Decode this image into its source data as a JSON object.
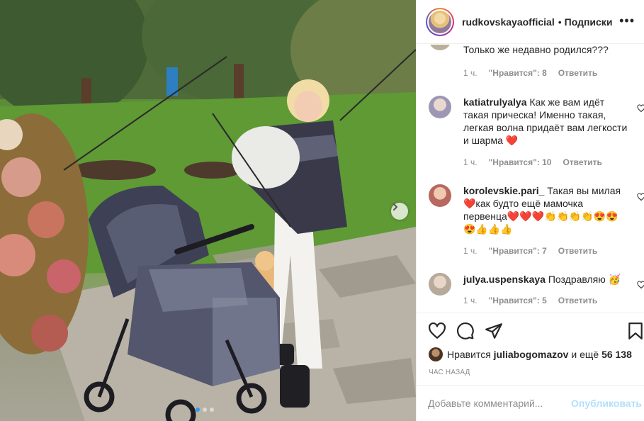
{
  "header": {
    "username": "rudkovskayaofficial",
    "separator": "•",
    "follow_label": "Подписки",
    "more_label": "•••"
  },
  "comments": [
    {
      "user": "",
      "text": "Только же недавно родился???",
      "time": "1 ч.",
      "likes": "\"Нравится\": 8",
      "reply_label": "Ответить",
      "avatar_color": "#b9b09a"
    },
    {
      "user": "katiatrulyalya",
      "text": "Как же вам идёт такая прическа! Именно такая, легкая волна придаёт вам легкости и шарма ❤️",
      "time": "1 ч.",
      "likes": "\"Нравится\": 10",
      "reply_label": "Ответить",
      "avatar_color": "#c8c4d6"
    },
    {
      "user": "korolevskie.pari_",
      "text": "Такая вы милая ❤️как будто ещё мамочка первенца❤️❤️❤️👏👏👏👏😍😍😍👍👍👍",
      "time": "1 ч.",
      "likes": "\"Нравится\": 7",
      "reply_label": "Ответить",
      "avatar_color": "#d9a58f"
    },
    {
      "user": "julya.uspenskaya",
      "text": "Поздравляю 🥳",
      "time": "1 ч.",
      "likes": "\"Нравится\": 5",
      "reply_label": "Ответить",
      "avatar_color": "#d6cfc6"
    }
  ],
  "actions": {
    "likes_prefix": "Нравится",
    "likes_user": "juliabogomazov",
    "likes_and": "и ещё",
    "likes_count": "56 138",
    "timestamp": "ЧАС НАЗАД"
  },
  "add_comment": {
    "placeholder": "Добавьте комментарий...",
    "publish_label": "Опубликовать"
  },
  "carousel": {
    "current_slide": 1,
    "total_slides": 3
  },
  "colors": {
    "accent": "#3897f0",
    "publish_disabled": "#b2dffc",
    "secondary_text": "#8e8e8e",
    "heart_red": "#ed4956"
  },
  "icons": [
    "heart-icon",
    "comment-icon",
    "share-icon",
    "bookmark-icon",
    "chevron-right-icon",
    "more-icon"
  ]
}
